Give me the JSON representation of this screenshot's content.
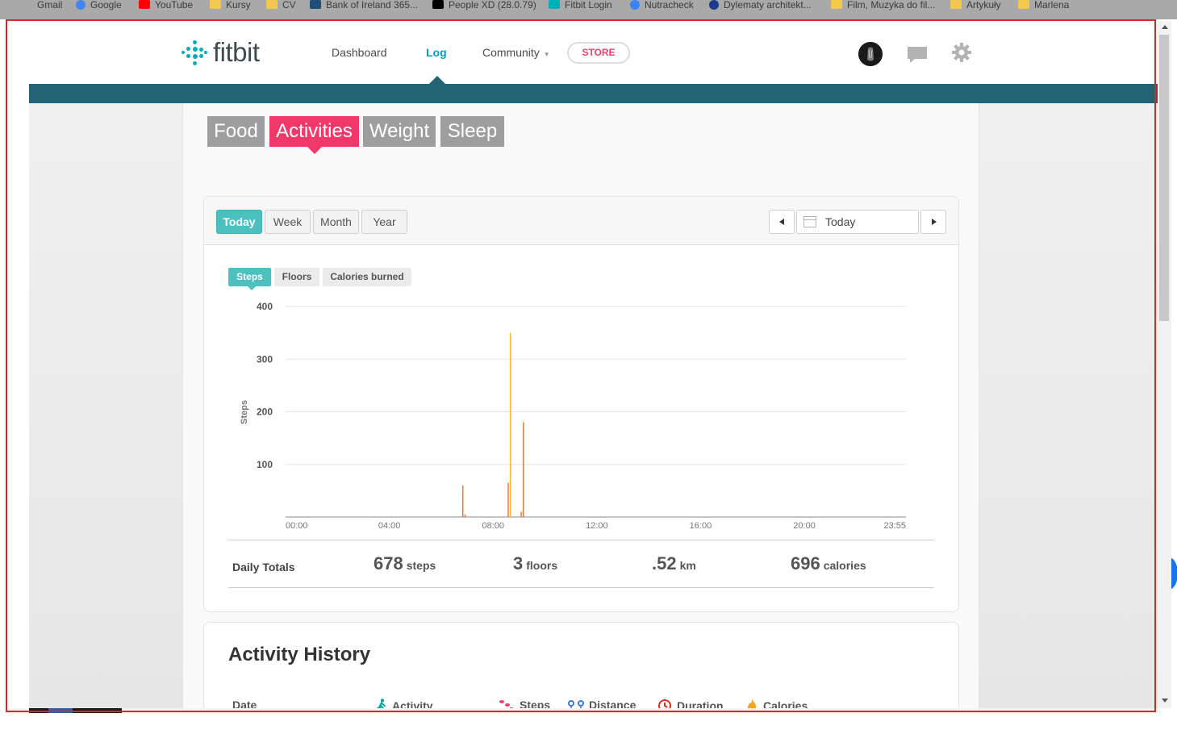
{
  "bookmarks": [
    {
      "label": "Gmail",
      "color": "#d44638"
    },
    {
      "label": "Google",
      "color": "#4285f4"
    },
    {
      "label": "YouTube",
      "color": "#ff0000"
    },
    {
      "label": "Kursy",
      "color": "#f2c94c"
    },
    {
      "label": "CV",
      "color": "#f2c94c"
    },
    {
      "label": "Bank of Ireland 365...",
      "color": "#1f4e79"
    },
    {
      "label": "People XD (28.0.79)",
      "color": "#000000"
    },
    {
      "label": "Fitbit Login",
      "color": "#00b0b9"
    },
    {
      "label": "Nutracheck",
      "color": "#3b82f6"
    },
    {
      "label": "Dylematy architekt...",
      "color": "#1e3a8a"
    },
    {
      "label": "Film, Muzyka do fil...",
      "color": "#f2c94c"
    },
    {
      "label": "Artykuły",
      "color": "#f2c94c"
    },
    {
      "label": "Marlena",
      "color": "#f2c94c"
    }
  ],
  "header": {
    "logo_text": "fitbit",
    "nav": {
      "dashboard": "Dashboard",
      "log": "Log",
      "community": "Community",
      "store": "STORE"
    },
    "accent_color": "#00a1c1",
    "bar_color": "#236373"
  },
  "categories": {
    "food": "Food",
    "activities": "Activities",
    "weight": "Weight",
    "sleep": "Sleep",
    "active_color": "#f0386b"
  },
  "range": {
    "today": "Today",
    "week": "Week",
    "month": "Month",
    "year": "Year"
  },
  "date_picker": {
    "value": "Today"
  },
  "metrics": {
    "steps": "Steps",
    "floors": "Floors",
    "calories": "Calories burned"
  },
  "chart_data": {
    "type": "bar",
    "title": "",
    "ylabel": "Steps",
    "xlabel": "",
    "ylim": [
      0,
      400
    ],
    "yticks": [
      100,
      200,
      300,
      400
    ],
    "xlim_minutes": [
      0,
      1435
    ],
    "xticks": [
      "00:00",
      "04:00",
      "08:00",
      "12:00",
      "16:00",
      "20:00",
      "23:55"
    ],
    "grid": true,
    "series": [
      {
        "x": [
          "06:50",
          "06:55",
          "08:35",
          "08:40",
          "09:05",
          "09:10"
        ],
        "values": [
          60,
          5,
          65,
          350,
          10,
          180
        ],
        "colors": [
          "#f2762e",
          "#f2762e",
          "#f2762e",
          "#f2b82e",
          "#f2762e",
          "#f2762e"
        ]
      }
    ]
  },
  "daily_totals": {
    "label": "Daily Totals",
    "steps": {
      "value": "678",
      "unit": "steps"
    },
    "floors": {
      "value": "3",
      "unit": "floors"
    },
    "distance": {
      "value": ".52",
      "unit": "km"
    },
    "calories": {
      "value": "696",
      "unit": "calories"
    }
  },
  "activity_history": {
    "title": "Activity History",
    "columns": {
      "date": "Date",
      "activity": "Activity",
      "steps": "Steps",
      "distance": "Distance",
      "duration": "Duration",
      "calories": "Calories"
    }
  }
}
